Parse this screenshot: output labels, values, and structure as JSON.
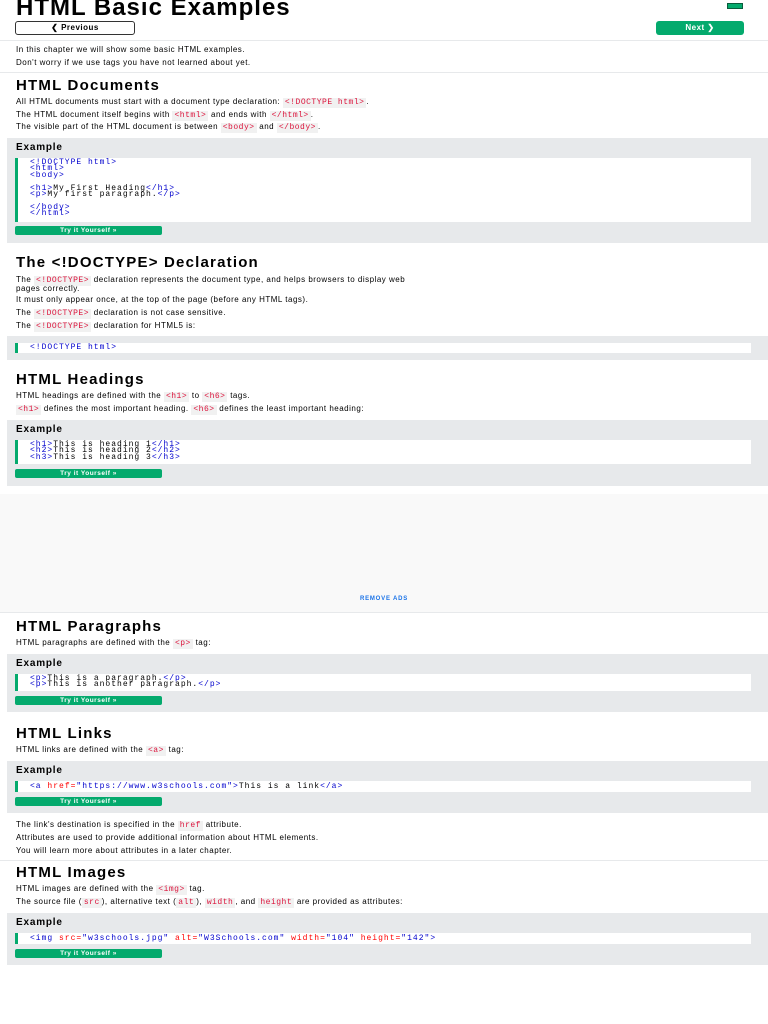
{
  "header": {
    "title": "HTML Basic Examples",
    "prev_label": "❮ Previous",
    "next_label": "Next ❯"
  },
  "intro": {
    "line1": "In this chapter we will show some basic HTML examples.",
    "line2": "Don't worry if we use tags you have not learned about yet."
  },
  "documents": {
    "heading": "HTML Documents",
    "p1_a": "All HTML documents must start with a document type declaration: ",
    "p1_tag": "<!DOCTYPE html>",
    "p1_b": ".",
    "p2_a": "The HTML document itself begins with ",
    "p2_tag1": "<html>",
    "p2_b": " and ends with ",
    "p2_tag2": "</html>",
    "p2_c": ".",
    "p3_a": "The visible part of the HTML document is between ",
    "p3_tag1": "<body>",
    "p3_b": " and ",
    "p3_tag2": "</body>",
    "p3_c": ".",
    "example_title": "Example",
    "code": {
      "l1": "<!DOCTYPE html>",
      "l2": "<html>",
      "l3": "<body>",
      "l4a": "<h1>",
      "l4b": "My First Heading",
      "l4c": "</h1>",
      "l5a": "<p>",
      "l5b": "My first paragraph.",
      "l5c": "</p>",
      "l6": "</body>",
      "l7": "</html>"
    },
    "try_label": "Try it Yourself »"
  },
  "doctype": {
    "heading": "The <!DOCTYPE> Declaration",
    "p1_a": "The ",
    "p1_tag": "<!DOCTYPE>",
    "p1_b": " declaration represents the document type, and helps browsers to display web",
    "p1_c": "pages correctly.",
    "p2": "It must only appear once, at the top of the page (before any HTML tags).",
    "p3_a": "The ",
    "p3_tag": "<!DOCTYPE>",
    "p3_b": " declaration is not case sensitive.",
    "p4_a": "The ",
    "p4_tag": "<!DOCTYPE>",
    "p4_b": " declaration for HTML5 is:",
    "code": "<!DOCTYPE html>"
  },
  "headings": {
    "heading": "HTML Headings",
    "p1_a": "HTML headings are defined with the ",
    "p1_tag1": "<h1>",
    "p1_b": " to ",
    "p1_tag2": "<h6>",
    "p1_c": " tags.",
    "p2_tag1": "<h1>",
    "p2_a": " defines the most important heading. ",
    "p2_tag2": "<h6>",
    "p2_b": " defines the least important heading:",
    "example_title": "Example",
    "code": {
      "l1a": "<h1>",
      "l1b": "This is heading 1",
      "l1c": "</h1>",
      "l2a": "<h2>",
      "l2b": "This is heading 2",
      "l2c": "</h2>",
      "l3a": "<h3>",
      "l3b": "This is heading 3",
      "l3c": "</h3>"
    },
    "try_label": "Try it Yourself »"
  },
  "ad": {
    "remove_label": "REMOVE ADS"
  },
  "paragraphs": {
    "heading": "HTML Paragraphs",
    "p1_a": "HTML paragraphs are defined with the ",
    "p1_tag": "<p>",
    "p1_b": " tag:",
    "example_title": "Example",
    "code": {
      "l1a": "<p>",
      "l1b": "This is a paragraph.",
      "l1c": "</p>",
      "l2a": "<p>",
      "l2b": "This is another paragraph.",
      "l2c": "</p>"
    },
    "try_label": "Try it Yourself »"
  },
  "links": {
    "heading": "HTML Links",
    "p1_a": "HTML links are defined with the ",
    "p1_tag": "<a>",
    "p1_b": " tag:",
    "example_title": "Example",
    "code": {
      "a": "<a",
      "attr": " href=",
      "val": "\"https://www.w3schools.com\"",
      "b": ">",
      "text": "This is a link",
      "c": "</a>"
    },
    "try_label": "Try it Yourself »",
    "p2_a": "The link's destination is specified in the ",
    "p2_tag": "href",
    "p2_b": " attribute.",
    "p3": "Attributes are used to provide additional information about HTML elements.",
    "p4": "You will learn more about attributes in a later chapter."
  },
  "images": {
    "heading": "HTML Images",
    "p1_a": "HTML images are defined with the ",
    "p1_tag": "<img>",
    "p1_b": " tag.",
    "p2_a": "The source file (",
    "p2_tag1": "src",
    "p2_b": "), alternative text (",
    "p2_tag2": "alt",
    "p2_c": "), ",
    "p2_tag3": "width",
    "p2_d": ", and ",
    "p2_tag4": "height",
    "p2_e": " are provided as attributes:",
    "example_title": "Example",
    "code": {
      "a": "<img",
      "attr1": " src=",
      "val1": "\"w3schools.jpg\"",
      "attr2": " alt=",
      "val2": "\"W3Schools.com\"",
      "attr3": " width=",
      "val3": "\"104\"",
      "attr4": " height=",
      "val4": "\"142\"",
      "b": ">"
    },
    "try_label": "Try it Yourself »"
  }
}
